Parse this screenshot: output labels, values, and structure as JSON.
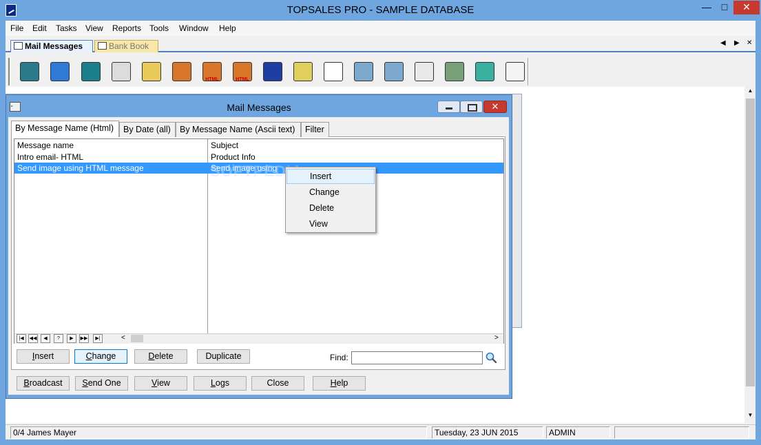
{
  "app": {
    "title": "TOPSALES PRO - SAMPLE DATABASE",
    "min_glyph": "—",
    "max_glyph": "□",
    "close_glyph": "✕"
  },
  "menu": [
    "File",
    "Edit",
    "Tasks",
    "View",
    "Reports",
    "Tools",
    "Window",
    "Help"
  ],
  "doc_tabs": [
    {
      "label": "Mail Messages",
      "active": true
    },
    {
      "label": "Bank Book",
      "active": false
    }
  ],
  "nav_arrows": {
    "left": "◀",
    "right": "▶",
    "close": "✕"
  },
  "toolbar": {
    "buttons": [
      {
        "icon": "bank-icon",
        "color": "#2a7a8a"
      },
      {
        "icon": "globe-computer-icon",
        "color": "#2f7ad6"
      },
      {
        "icon": "calculator-icon",
        "color": "#1c7f8a"
      },
      {
        "icon": "calendar-97-icon",
        "color": "#dcdcdc"
      },
      {
        "icon": "mail-tray-icon",
        "color": "#e8c95a"
      },
      {
        "icon": "contacts-icon",
        "color": "#d9762a"
      },
      {
        "icon": "contacts-html-icon",
        "color": "#d9762a",
        "badge": "HTML"
      },
      {
        "icon": "contacts-html-2-icon",
        "color": "#d9762a",
        "badge": "HTML"
      },
      {
        "icon": "dollar-document-icon",
        "color": "#1f3ea3"
      },
      {
        "icon": "cash-register-icon",
        "color": "#e0cf5c"
      },
      {
        "icon": "document-chart-icon",
        "color": "#ffffff"
      },
      {
        "icon": "shelves-icon",
        "color": "#7ba8cc"
      },
      {
        "icon": "shelves-2-icon",
        "color": "#7ba8cc"
      },
      {
        "icon": "write-letter-icon",
        "color": "#e9e9e9"
      },
      {
        "icon": "safe-icon",
        "color": "#7aa07a"
      },
      {
        "icon": "scanner-icon",
        "color": "#3ab0a0"
      },
      {
        "icon": "stopwatch-icon",
        "color": "#f4f4f4"
      }
    ]
  },
  "mail_window": {
    "title": "Mail Messages",
    "sys_icon": "⁃",
    "close_glyph": "✕",
    "tabs": [
      "By Message Name (Html)",
      "By Date (all)",
      "By Message Name (Ascii text)",
      "Filter"
    ],
    "columns": [
      "Message name",
      "Subject"
    ],
    "rows": [
      {
        "name": "Intro email- HTML",
        "subject": "Product Info"
      },
      {
        "name": "Send image using HTML message",
        "subject": "Send image using"
      }
    ],
    "nav_buttons": [
      "|◀",
      "◀◀",
      "◀",
      "?",
      "▶",
      "▶▶",
      "▶|"
    ],
    "hscroll": {
      "left": "<",
      "right": ">"
    },
    "action_buttons": [
      {
        "label": "Insert",
        "key": "I",
        "rest": "nsert"
      },
      {
        "label": "Change",
        "key": "C",
        "rest": "hange"
      },
      {
        "label": "Delete",
        "key": "D",
        "rest": "elete"
      },
      {
        "label": "Duplicate",
        "key": "",
        "rest": "Duplicate"
      }
    ],
    "find_label": "Find:",
    "find_value": "",
    "bottom_buttons": [
      {
        "key": "B",
        "rest": "roadcast"
      },
      {
        "key": "S",
        "rest": "end One"
      },
      {
        "key": "V",
        "rest": "iew"
      },
      {
        "key": "L",
        "rest": "ogs"
      },
      {
        "key": "",
        "rest": "Close"
      },
      {
        "key": "H",
        "rest": "elp"
      }
    ]
  },
  "context_menu": [
    "Insert",
    "Change",
    "Delete",
    "View"
  ],
  "watermark": "SOFTPEDIA",
  "status": {
    "record": "0/4  James Mayer",
    "date": "Tuesday, 23 JUN 2015",
    "user": "ADMIN",
    "extra": ""
  },
  "scroll": {
    "up": "▲",
    "down": "▼"
  }
}
